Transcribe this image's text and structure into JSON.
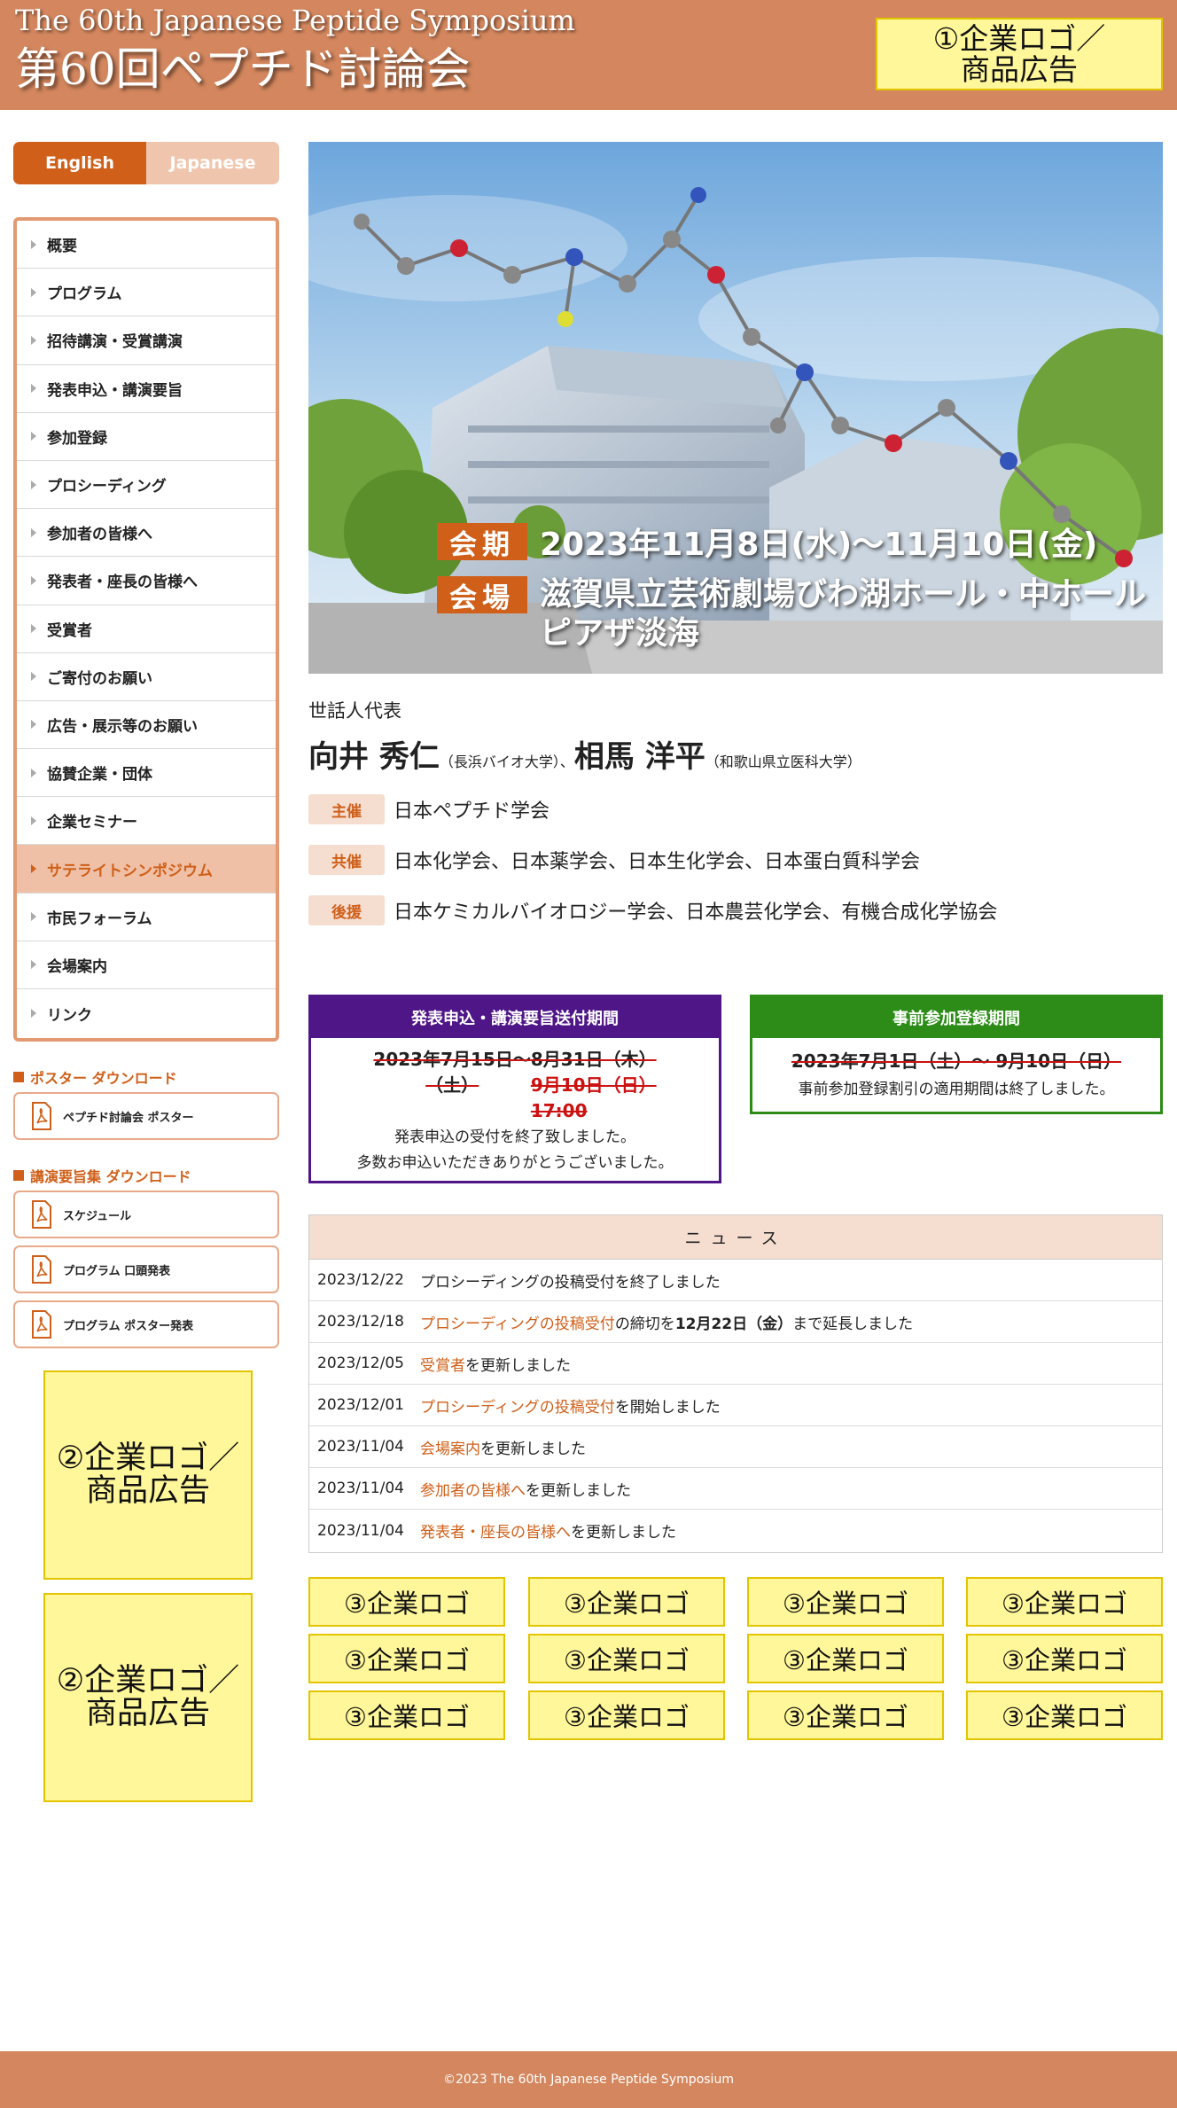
{
  "header": {
    "title_en": "The 60th Japanese Peptide Symposium",
    "title_jp": "第60回ペプチド討論会",
    "ad_top": [
      "①企業ロゴ／",
      "商品広告"
    ]
  },
  "language": {
    "english": "English",
    "japanese": "Japanese"
  },
  "sidebar": {
    "nav_items": [
      "概要",
      "プログラム",
      "招待講演・受賞講演",
      "発表申込・講演要旨",
      "参加登録",
      "プロシーディング",
      "参加者の皆様へ",
      "発表者・座長の皆様へ",
      "受賞者",
      "ご寄付のお願い",
      "広告・展示等のお願い",
      "協賛企業・団体",
      "企業セミナー",
      "サテライトシンポジウム",
      "市民フォーラム",
      "会場案内",
      "リンク"
    ],
    "active_index": 13,
    "poster_heading": "ポスター ダウンロード",
    "poster_links": [
      "ペプチド討論会 ポスター"
    ],
    "abstract_heading": "講演要旨集 ダウンロード",
    "abstract_links": [
      "スケジュール",
      "プログラム 口頭発表",
      "プログラム ポスター発表"
    ],
    "ad_side": [
      "②企業ロゴ／",
      "商品広告"
    ]
  },
  "hero": {
    "period_label": "会期",
    "period_value": "2023年11月8日(水)〜11月10日(金)",
    "venue_label": "会場",
    "venue_line1": "滋賀県立芸術劇場びわ湖ホール・中ホール",
    "venue_line2": "ピアザ淡海"
  },
  "organizers": {
    "label": "世話人代表",
    "name1": "向井 秀仁",
    "aff1": "（長浜バイオ大学）",
    "sep": "、",
    "name2": "相馬 洋平",
    "aff2": "（和歌山県立医科大学）",
    "rows": [
      {
        "tag": "主催",
        "text": "日本ペプチド学会"
      },
      {
        "tag": "共催",
        "text": "日本化学会、日本薬学会、日本生化学会、日本蛋白質科学会"
      },
      {
        "tag": "後援",
        "text": "日本ケミカルバイオロジー学会、日本農芸化学会、有機合成化学協会"
      }
    ]
  },
  "submission_period": {
    "title": "発表申込・講演要旨送付期間",
    "date_a": "2023年7月15日〜",
    "date_a2": "（土）",
    "date_b": "8月31日（木）",
    "date_c": "9月10日（日）",
    "date_d": "17:00",
    "note1": "発表申込の受付を終了致しました。",
    "note2": "多数お申込いただきありがとうございました。",
    "color": "#4f1687"
  },
  "registration_period": {
    "title": "事前参加登録期間",
    "dates": "2023年7月1日（土）〜 9月10日（日）",
    "note": "事前参加登録割引の適用期間は終了しました。",
    "color": "#2c8c17"
  },
  "news": {
    "heading": "ニュース",
    "items": [
      {
        "date": "2023/12/22",
        "link": "",
        "text": "プロシーディングの投稿受付を終了しました"
      },
      {
        "date": "2023/12/18",
        "link": "プロシーディングの投稿受付",
        "text": "の締切を",
        "bold": "12月22日（金）",
        "tail": "まで延長しました"
      },
      {
        "date": "2023/12/05",
        "link": "受賞者",
        "text": "を更新しました"
      },
      {
        "date": "2023/12/01",
        "link": "プロシーディングの投稿受付",
        "text": "を開始しました"
      },
      {
        "date": "2023/11/04",
        "link": "会場案内",
        "text": "を更新しました"
      },
      {
        "date": "2023/11/04",
        "link": "参加者の皆様へ",
        "text": "を更新しました"
      },
      {
        "date": "2023/11/04",
        "link": "発表者・座長の皆様へ",
        "text": "を更新しました"
      }
    ]
  },
  "ads_bottom": {
    "label": "③企業ロゴ"
  },
  "footer": {
    "copyright": "©2023 The 60th Japanese Peptide Symposium"
  },
  "colors": {
    "header_bg": "#d4875e",
    "accent": "#cf5f19",
    "ad_bg": "#fff799"
  }
}
